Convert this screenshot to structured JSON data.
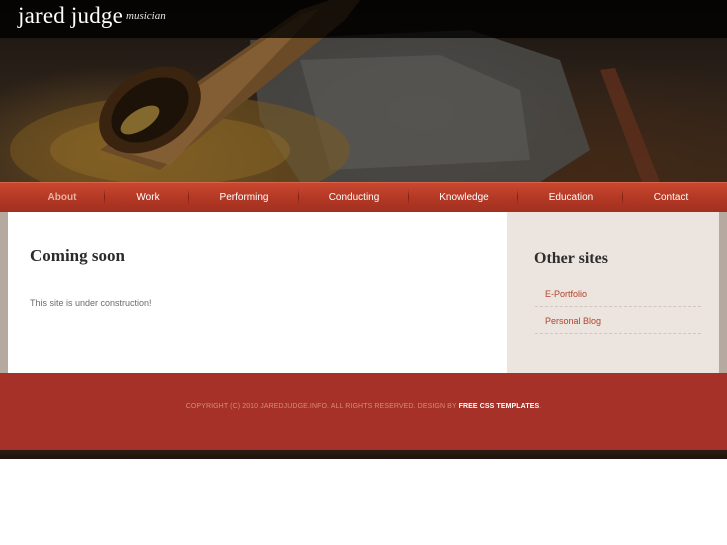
{
  "header": {
    "title": "jared judge",
    "tagline": "musician"
  },
  "nav": {
    "items": [
      {
        "label": "About",
        "active": true
      },
      {
        "label": "Work",
        "active": false
      },
      {
        "label": "Performing",
        "active": false
      },
      {
        "label": "Conducting",
        "active": false
      },
      {
        "label": "Knowledge",
        "active": false
      },
      {
        "label": "Education",
        "active": false
      },
      {
        "label": "Contact",
        "active": false
      }
    ]
  },
  "main": {
    "title": "Coming soon",
    "text": "This site is under construction!"
  },
  "sidebar": {
    "title": "Other sites",
    "links": [
      {
        "label": "E-Portfolio"
      },
      {
        "label": "Personal Blog"
      }
    ]
  },
  "footer": {
    "copyright": "COPYRIGHT (C) 2010 JAREDJUDGE.INFO. ALL RIGHTS RESERVED. DESIGN BY ",
    "link_label": "FREE CSS TEMPLATES",
    "suffix": "."
  },
  "colors": {
    "accent": "#b23824",
    "footer": "#a53129",
    "sidebar_bg": "#ece4de",
    "link": "#b2442a"
  }
}
